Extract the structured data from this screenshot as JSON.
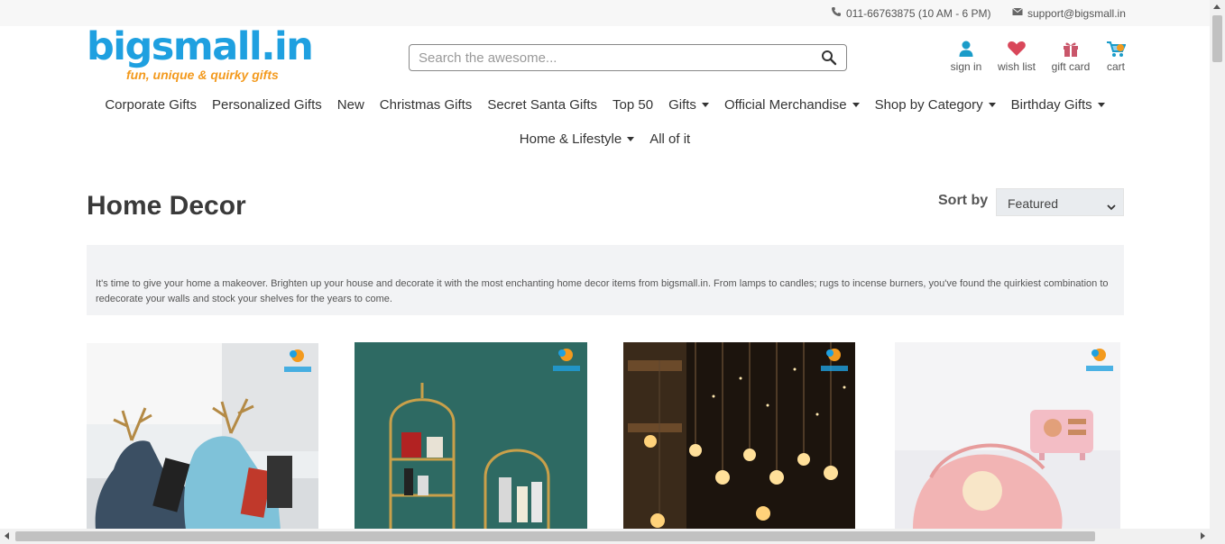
{
  "topbar": {
    "phone": "011-66763875 (10 AM - 6 PM)",
    "email": "support@bigsmall.in"
  },
  "logo": {
    "brand": "bigsmall.in",
    "tagline": "fun, unique & quirky gifts"
  },
  "search": {
    "placeholder": "Search the awesome..."
  },
  "header_icons": {
    "signin": "sign in",
    "wishlist": "wish list",
    "giftcard": "gift card",
    "cart": "cart"
  },
  "nav": {
    "row1": [
      "Corporate Gifts",
      "Personalized Gifts",
      "New",
      "Christmas Gifts",
      "Secret Santa Gifts",
      "Top 50",
      "Gifts",
      "Official Merchandise",
      "Shop by Category",
      "Birthday Gifts"
    ],
    "row2": [
      "Home & Lifestyle",
      "All of it"
    ]
  },
  "page": {
    "title": "Home Decor",
    "sort_label": "Sort by",
    "sort_value": "Featured",
    "description": "It's time to give your home a makeover. Brighten up your house and decorate it with the most enchanting home decor items from bigsmall.in. From lamps to candles; rugs to incense burners, you've found the quirkiest combination to redecorate your walls and stock your shelves for the years to come."
  },
  "colors": {
    "brand_blue": "#1fa0e0",
    "brand_orange": "#f39a1e",
    "wishlist_red": "#d9475a",
    "signin_teal": "#1a9cc9"
  }
}
